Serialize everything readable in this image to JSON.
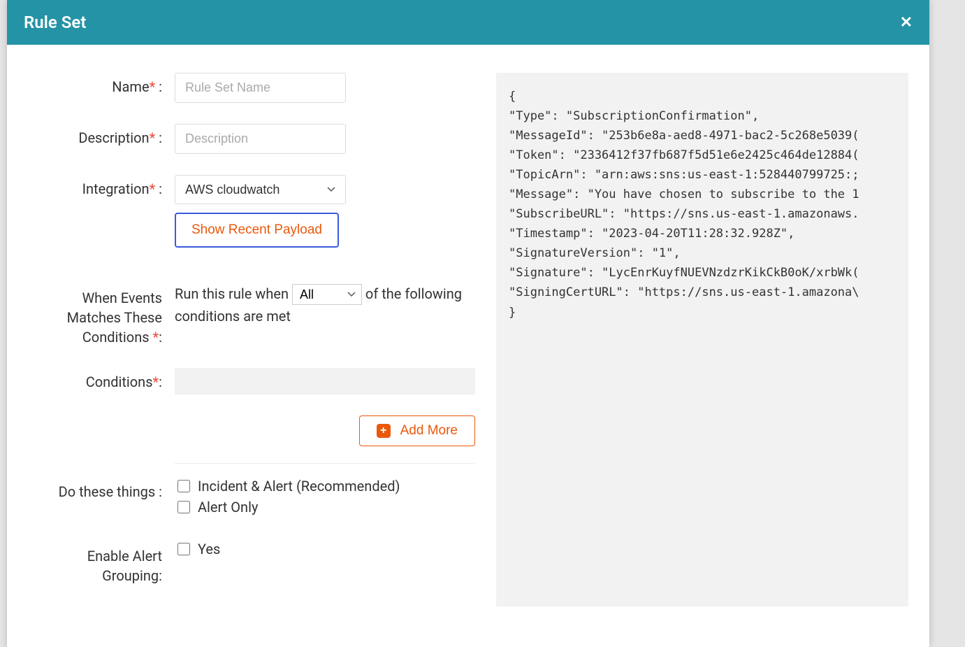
{
  "header": {
    "title": "Rule Set",
    "close": "✕"
  },
  "form": {
    "name_label": "Name",
    "name_placeholder": "Rule Set Name",
    "desc_label": "Description",
    "desc_placeholder": "Description",
    "integration_label": "Integration",
    "integration_value": "AWS cloudwatch",
    "show_payload_btn": "Show Recent Payload",
    "events_label": "When Events Matches These Conditions ",
    "run_prefix": "Run this rule when ",
    "match_mode": "All",
    "run_suffix": " of the following conditions are met",
    "conditions_label": "Conditions",
    "add_more": "Add More",
    "do_these_label": "Do these things :",
    "action_incident": "Incident & Alert (Recommended)",
    "action_alert": "Alert Only",
    "enable_group_label": "Enable Alert Grouping:",
    "enable_group_option": "Yes",
    "colon": " :",
    "required_colon": ":"
  },
  "payload": {
    "open": "{",
    "l1": "  \"Type\": \"SubscriptionConfirmation\",",
    "l2": "  \"MessageId\": \"253b6e8a-aed8-4971-bac2-5c268e5039(",
    "l3": "  \"Token\": \"2336412f37fb687f5d51e6e2425c464de12884(",
    "l4": "  \"TopicArn\": \"arn:aws:sns:us-east-1:528440799725:;",
    "l5": "  \"Message\": \"You have chosen to subscribe to the 1",
    "l6": "  \"SubscribeURL\": \"https://sns.us-east-1.amazonaws.",
    "l7": "  \"Timestamp\": \"2023-04-20T11:28:32.928Z\",",
    "l8": "  \"SignatureVersion\": \"1\",",
    "l9": "  \"Signature\": \"LycEnrKuyfNUEVNzdzrKikCkB0oK/xrbWk(",
    "l10": "  \"SigningCertURL\": \"https://sns.us-east-1.amazona\\",
    "close": "}"
  }
}
